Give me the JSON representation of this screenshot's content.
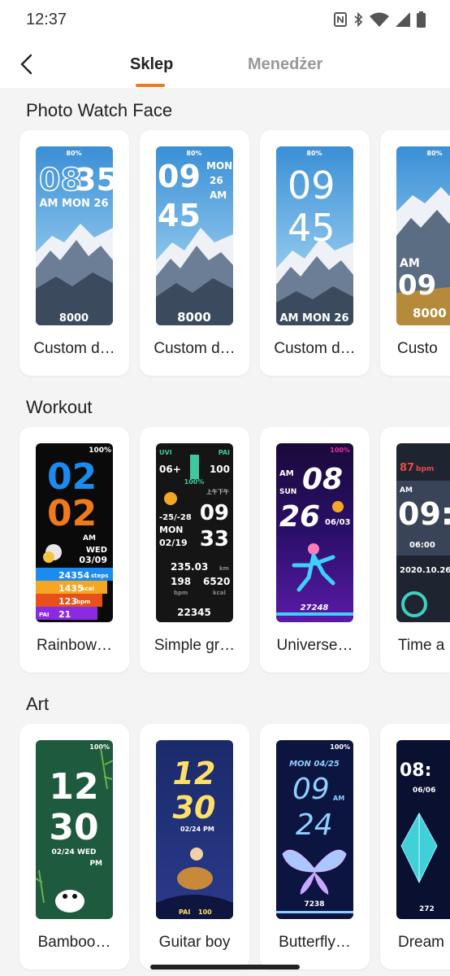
{
  "status": {
    "time": "12:37"
  },
  "header": {
    "tabs": [
      {
        "label": "Sklep",
        "active": true
      },
      {
        "label": "Menedżer",
        "active": false
      }
    ],
    "accent_color": "#f07a1a"
  },
  "sections": [
    {
      "title": "Photo Watch Face",
      "cards": [
        {
          "label": "Custom d…"
        },
        {
          "label": "Custom d…"
        },
        {
          "label": "Custom d…"
        },
        {
          "label": "Custo"
        }
      ]
    },
    {
      "title": "Workout",
      "cards": [
        {
          "label": "Rainbow…"
        },
        {
          "label": "Simple gr…"
        },
        {
          "label": "Universe…"
        },
        {
          "label": "Time a"
        }
      ]
    },
    {
      "title": "Art",
      "cards": [
        {
          "label": "Bamboo…"
        },
        {
          "label": "Guitar boy"
        },
        {
          "label": "Butterfly…"
        },
        {
          "label": "Dream"
        }
      ]
    }
  ],
  "faces": {
    "photo1": {
      "status": "80%",
      "time_h": "08",
      "time_m": "35",
      "date": "AM MON 26",
      "steps": "8000"
    },
    "photo2": {
      "status": "80%",
      "time_h": "09",
      "time_m": "45",
      "day": "MON",
      "daynum": "26",
      "ampm": "AM",
      "steps": "8000"
    },
    "photo3": {
      "status": "80%",
      "time_h": "09",
      "time_m": "45",
      "date": "AM MON 26"
    },
    "photo4": {
      "status": "80%",
      "ampm": "AM",
      "time": "09",
      "steps": "8000"
    },
    "rainbow": {
      "battery": "100%",
      "h": "02",
      "m": "02",
      "ampm": "AM",
      "day": "WED",
      "date": "03/09",
      "steps": "24354",
      "steps_unit": "steps",
      "kcal": "1435",
      "kcal_unit": "kcal",
      "bpm": "123",
      "bpm_unit": "bpm",
      "pai_label": "PAI",
      "pai": "21"
    },
    "simple": {
      "uvi": "UVI",
      "uvi_val": "06+",
      "pai_label": "PAI",
      "pai_val": "100",
      "pct": "100%",
      "zh": "上午下午",
      "temp": "-25/-28",
      "day": "MON",
      "date": "02/19",
      "h": "09",
      "m": "33",
      "dist": "235.03",
      "dist_unit": "km",
      "hr": "198",
      "cal": "6520",
      "hr_unit": "bpm",
      "cal_unit": "kcal",
      "steps": "22345"
    },
    "universe": {
      "battery": "100%",
      "ampm": "AM",
      "day": "SUN",
      "h": "08",
      "m": "26",
      "date": "06/03",
      "steps": "27248"
    },
    "time4": {
      "bpm": "87",
      "bpm_unit": "bpm",
      "ampm": "AM",
      "time": "09:",
      "alarm": "06:00",
      "date": "2020.10.26"
    },
    "bamboo": {
      "battery": "100%",
      "h": "12",
      "m": "30",
      "date": "02/24 WED",
      "ampm": "PM"
    },
    "guitar": {
      "h": "12",
      "m": "30",
      "date": "02/24",
      "ampm": "PM",
      "pai_label": "PAI",
      "pai": "100"
    },
    "butterfly": {
      "battery": "100%",
      "date": "MON 04/25",
      "h": "09",
      "ampm": "AM",
      "m": "24",
      "steps": "7238"
    },
    "dream": {
      "time": "08:",
      "date": "06/06",
      "steps": "272"
    }
  }
}
